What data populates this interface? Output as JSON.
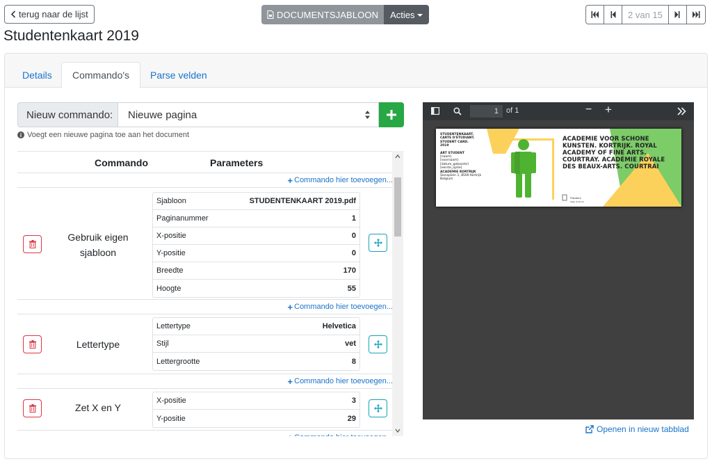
{
  "nav": {
    "back_label": "terug naar de lijst",
    "doc_template_label": "DOCUMENTSJABLOON",
    "acties_label": "Acties",
    "pager_count": "2 van 15"
  },
  "page": {
    "title": "Studentenkaart 2019"
  },
  "tabs": [
    {
      "label": "Details"
    },
    {
      "label": "Commando's"
    },
    {
      "label": "Parse velden"
    }
  ],
  "command_picker": {
    "label": "Nieuw commando:",
    "selected": "Nieuwe pagina",
    "help": "Voegt een nieuwe pagina toe aan het document"
  },
  "table": {
    "headers": {
      "command": "Commando",
      "parameters": "Parameters"
    },
    "add_here_label": "Commando hier toevoegen...",
    "commands": [
      {
        "name": "Gebruik eigen sjabloon",
        "params": [
          {
            "key": "Sjabloon",
            "value": "STUDENTENKAART 2019.pdf"
          },
          {
            "key": "Paginanummer",
            "value": "1"
          },
          {
            "key": "X-positie",
            "value": "0"
          },
          {
            "key": "Y-positie",
            "value": "0"
          },
          {
            "key": "Breedte",
            "value": "170"
          },
          {
            "key": "Hoogte",
            "value": "55"
          }
        ]
      },
      {
        "name": "Lettertype",
        "params": [
          {
            "key": "Lettertype",
            "value": "Helvetica"
          },
          {
            "key": "Stijl",
            "value": "vet"
          },
          {
            "key": "Lettergrootte",
            "value": "8"
          }
        ]
      },
      {
        "name": "Zet X en Y",
        "params": [
          {
            "key": "X-positie",
            "value": "3"
          },
          {
            "key": "Y-positie",
            "value": "29"
          }
        ]
      }
    ]
  },
  "pdf": {
    "page_input": "1",
    "of_label": "of 1",
    "card": {
      "left_lines": [
        "STUDENTENKAART.",
        "CARTE D'ÉTUDIANT.",
        "STUDENT CARD.",
        "2019"
      ],
      "role": "ART STUDENT",
      "fields": [
        "[naam]",
        "[voornaam]",
        "[datum_geboorte]",
        "[eerste_optie]"
      ],
      "institution": "ACADEMIE KORTRIJK",
      "address": [
        "Sionsplein 1, 8500 Kortrijk",
        "Belgium"
      ],
      "title": "ACADEMIE VOOR SCHONE KUNSTEN. KORTRIJK. ROYAL ACADEMY OF FINE ARTS. COURTRAY. ACADÉMIE ROYALE DES BEAUX-ARTS. COURTRAI",
      "flanders": "Flanders",
      "flanders_sub": "State of the Art"
    }
  },
  "open_link_label": "Openen in nieuw tabblad",
  "colors": {
    "primary": "#1a73c9",
    "success": "#28a745",
    "danger": "#dc3545",
    "info": "#17a2b8",
    "card_green": "#6dc74f",
    "card_yellow": "#fcd15b"
  },
  "icons": {
    "back": "chevron-left-icon",
    "doc": "file-pdf-icon",
    "first": "first-page-icon",
    "prev": "prev-page-icon",
    "next": "next-page-icon",
    "last": "last-page-icon",
    "add": "plus-icon",
    "delete": "trash-icon",
    "move": "move-arrows-icon",
    "external": "external-link-icon"
  }
}
